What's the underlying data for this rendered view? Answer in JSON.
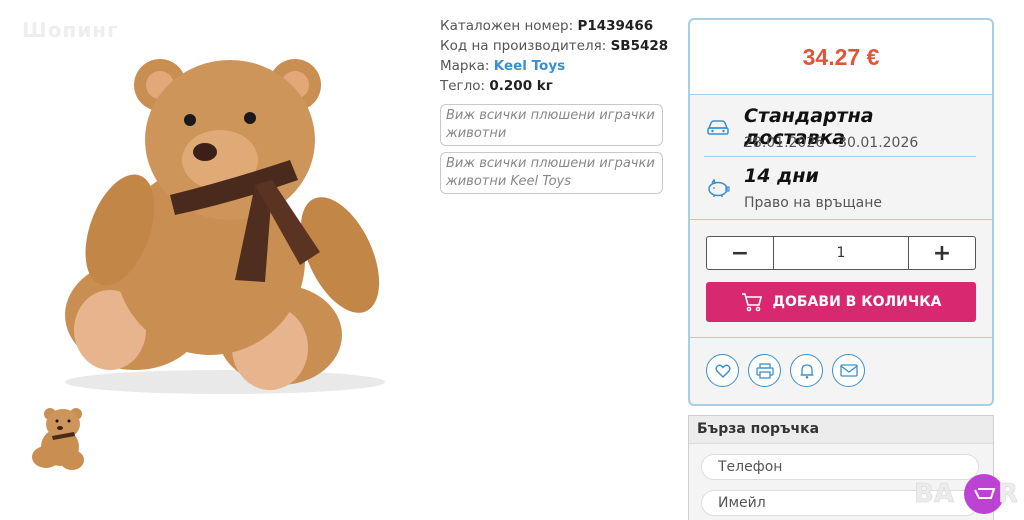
{
  "watermark": "Шопинг",
  "product": {
    "catalog_label": "Каталожен номер:",
    "catalog_value": "P1439466",
    "maker_code_label": "Код на производителя:",
    "maker_code_value": "SB5428",
    "brand_label": "Марка:",
    "brand_value": "Keel Toys",
    "weight_label": "Тегло:",
    "weight_value": "0.200 kг",
    "tag1": "Виж всички плюшени играчки животни",
    "tag2": "Виж всички плюшени играчки животни Keel Toys"
  },
  "buybox": {
    "price": "34.27 €",
    "delivery_title": "Стандартна доставка",
    "delivery_dates": "28.01.2026 - 30.01.2026",
    "return_title": "14 дни",
    "return_sub": "Право на връщане",
    "qty_minus": "−",
    "qty_value": "1",
    "qty_plus": "+",
    "cart_label": "ДОБАВИ В КОЛИЧКА"
  },
  "quick_order": {
    "title": "Бърза поръчка",
    "phone_placeholder": "Телефон",
    "email_placeholder": "Имейл"
  },
  "colors": {
    "price": "#e2543a",
    "cart_button": "#d8286f",
    "border_accent": "#a9cfe6",
    "brand_link": "#3a8fd0"
  },
  "icons": [
    "car-icon",
    "piggy-bank-icon",
    "cart-icon",
    "heart-icon",
    "print-icon",
    "bell-icon",
    "envelope-icon"
  ]
}
